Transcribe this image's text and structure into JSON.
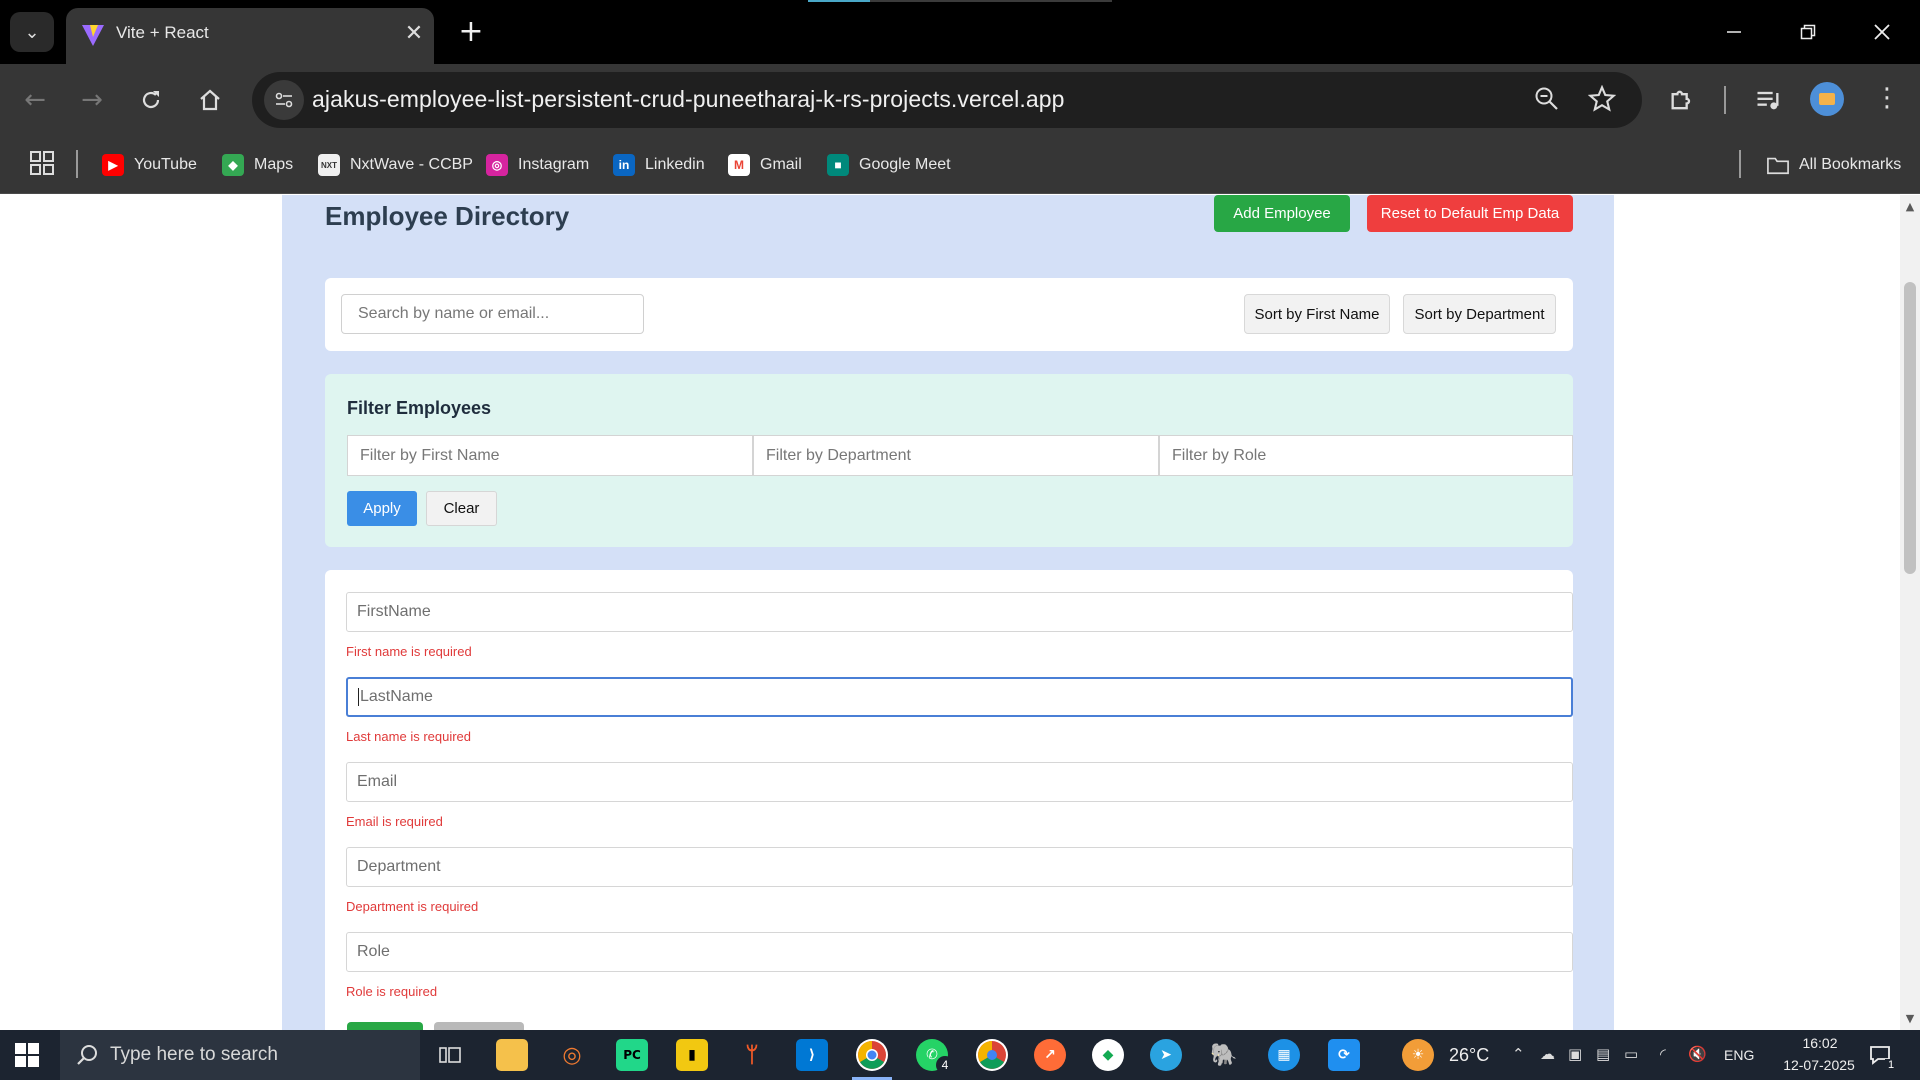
{
  "browser": {
    "tab_title": "Vite + React",
    "url": "ajakus-employee-list-persistent-crud-puneetharaj-k-rs-projects.vercel.app",
    "bookmarks": [
      {
        "label": "YouTube",
        "icon": "youtube-icon",
        "color": "#ff0000"
      },
      {
        "label": "Maps",
        "icon": "maps-icon",
        "color": "#34a853"
      },
      {
        "label": "NxtWave - CCBP",
        "icon": "nxtwave-icon",
        "color": "#f0f0f0"
      },
      {
        "label": "Instagram",
        "icon": "instagram-icon",
        "color": "#d6249f"
      },
      {
        "label": "Linkedin",
        "icon": "linkedin-icon",
        "color": "#0a66c2"
      },
      {
        "label": "Gmail",
        "icon": "gmail-icon",
        "color": "#ea4335"
      },
      {
        "label": "Google Meet",
        "icon": "google-meet-icon",
        "color": "#00897b"
      }
    ],
    "all_bookmarks": "All Bookmarks"
  },
  "app": {
    "title": "Employee Directory",
    "add_button": "Add Employee",
    "reset_button": "Reset to Default Emp Data",
    "search_placeholder": "Search by name or email...",
    "sort_first_name": "Sort by First Name",
    "sort_department": "Sort by Department",
    "filter": {
      "heading": "Filter Employees",
      "first_name_placeholder": "Filter by First Name",
      "department_placeholder": "Filter by Department",
      "role_placeholder": "Filter by Role",
      "apply": "Apply",
      "clear": "Clear"
    },
    "form": {
      "fields": [
        {
          "placeholder": "FirstName",
          "error": "First name is required"
        },
        {
          "placeholder": "LastName",
          "error": "Last name is required"
        },
        {
          "placeholder": "Email",
          "error": "Email is required"
        },
        {
          "placeholder": "Department",
          "error": "Department is required"
        },
        {
          "placeholder": "Role",
          "error": "Role is required"
        }
      ]
    }
  },
  "taskbar": {
    "search_placeholder": "Type here to search",
    "weather": "26°C",
    "language": "ENG",
    "time": "16:02",
    "date": "12-07-2025",
    "whatsapp_badge": "4",
    "notification_count": "1"
  },
  "colors": {
    "accent_green": "#28a745",
    "accent_red": "#ef3e3e",
    "accent_blue": "#3a8ee6",
    "error_red": "#e03a3a",
    "app_background": "#d4e0f7",
    "filter_background": "#dff5f0"
  }
}
